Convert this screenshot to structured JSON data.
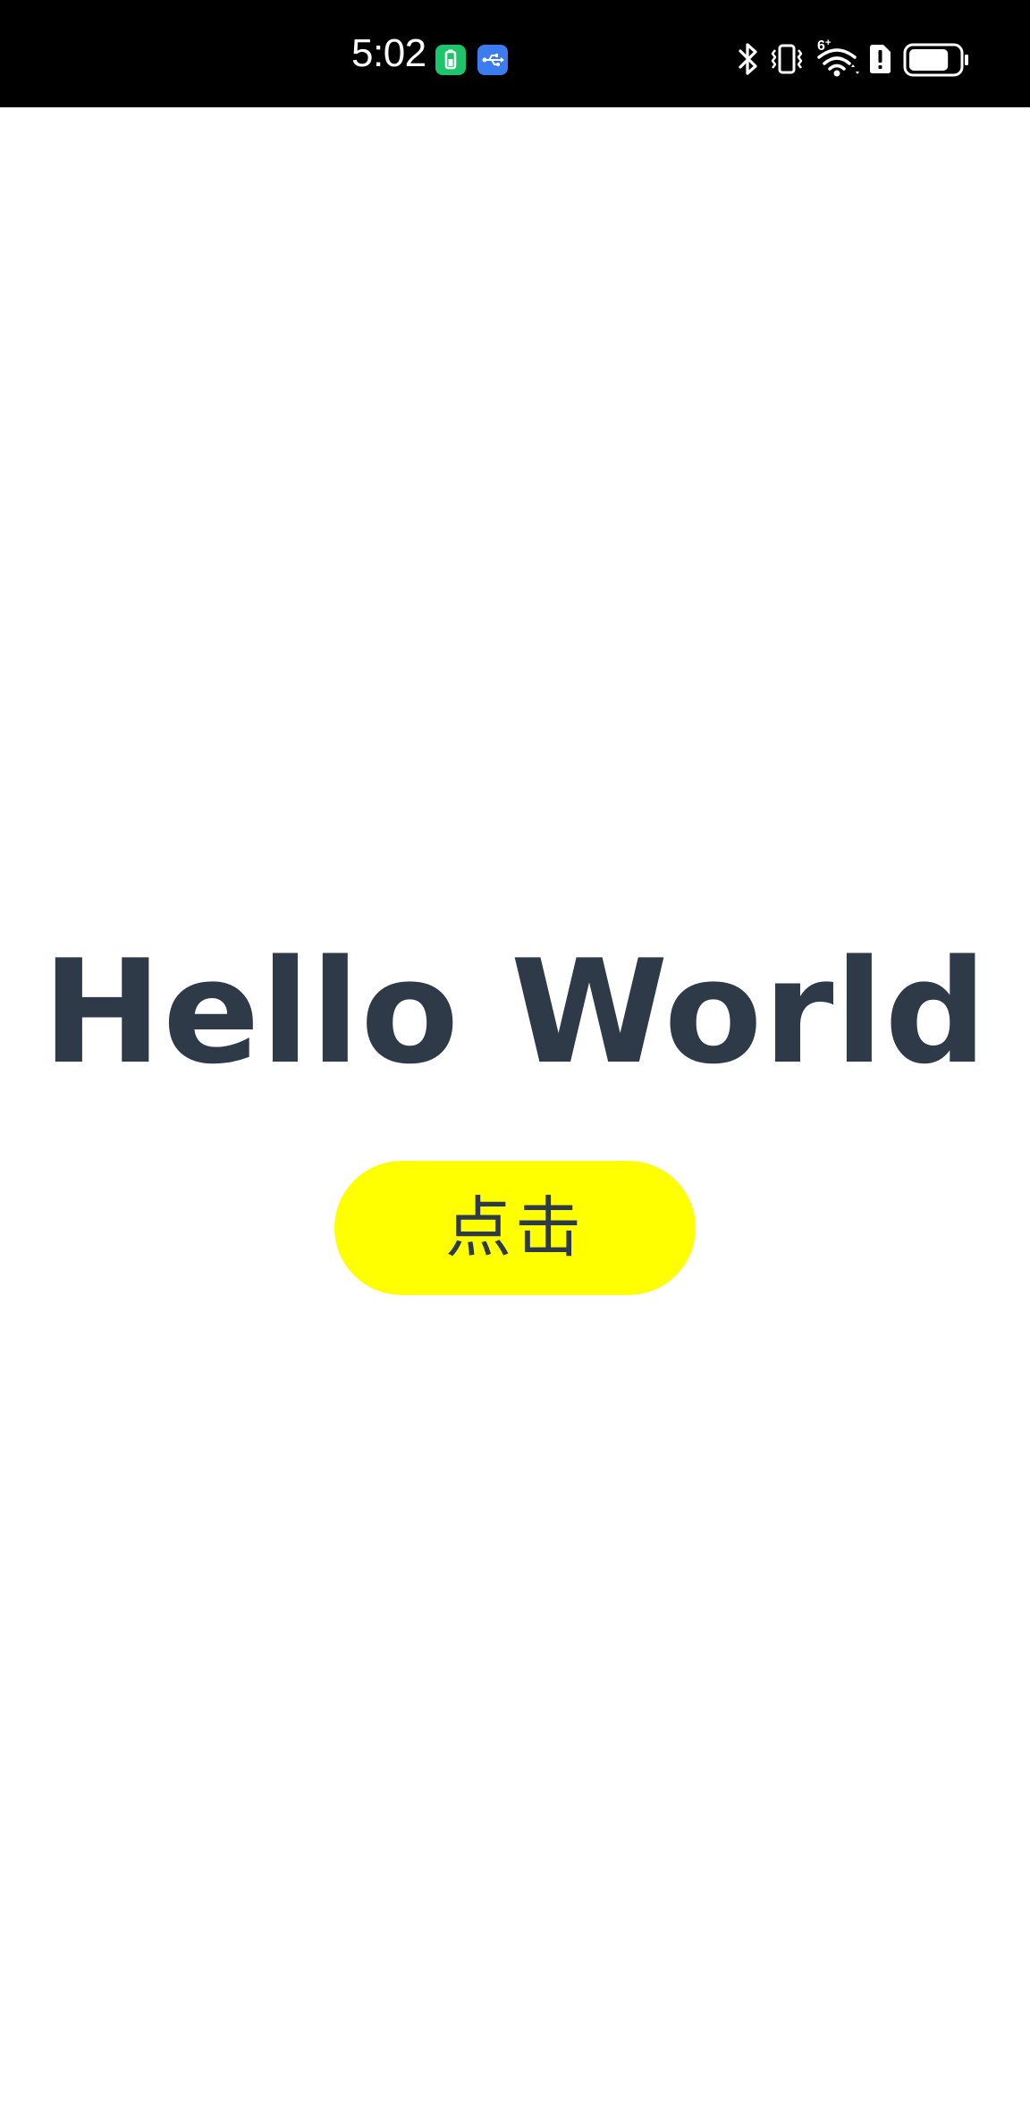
{
  "status_bar": {
    "time": "5:02",
    "notification_icons": [
      "battery-saver-icon",
      "usb-icon"
    ],
    "system_icons": [
      "bluetooth-icon",
      "vibrate-icon",
      "wifi-6-icon",
      "sim-alert-icon",
      "battery-icon"
    ],
    "wifi_badge": "6⁺",
    "battery_level": 0.8
  },
  "main": {
    "title": "Hello World",
    "button_label": "点击"
  },
  "colors": {
    "status_bar_bg": "#000000",
    "background": "#ffffff",
    "text": "#2e3a48",
    "button_bg": "#ffff00"
  }
}
